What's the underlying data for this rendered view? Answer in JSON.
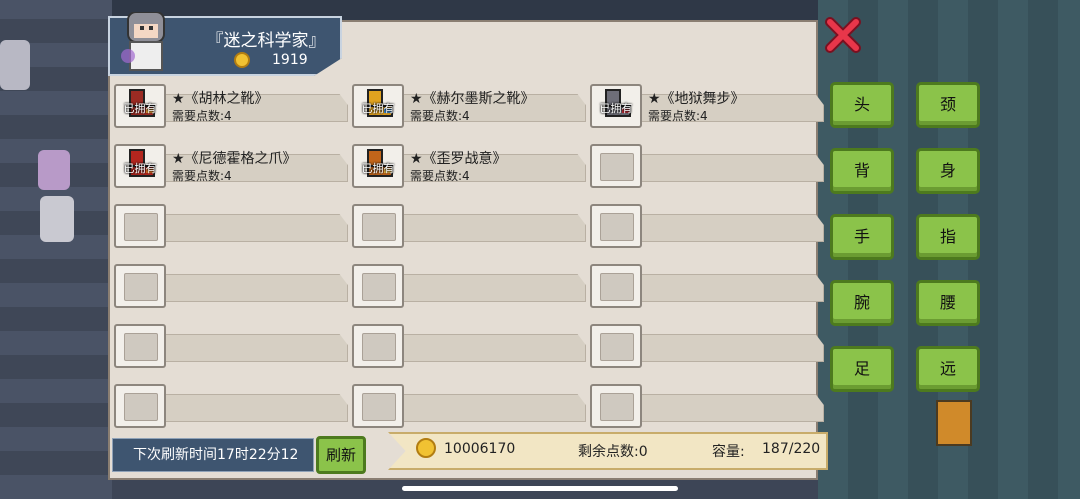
{
  "header": {
    "title": "『迷之科学家』",
    "coins": "1919"
  },
  "items": [
    {
      "name": "★《胡林之靴》",
      "cost": "需要点数:4",
      "owned": "已拥有",
      "color": "#9b2b23",
      "accent": "#e6a03a"
    },
    {
      "name": "★《赫尔墨斯之靴》",
      "cost": "需要点数:4",
      "owned": "已拥有",
      "color": "#e0a21f",
      "accent": "#3f8fd9"
    },
    {
      "name": "★《地狱舞步》",
      "cost": "需要点数:4",
      "owned": "已拥有",
      "color": "#6e6e78",
      "accent": "#c8303a"
    },
    {
      "name": "★《尼德霍格之爪》",
      "cost": "需要点数:4",
      "owned": "已拥有",
      "color": "#b3261e",
      "accent": "#ef7b2c"
    },
    {
      "name": "★《歪罗战意》",
      "cost": "需要点数:4",
      "owned": "已拥有",
      "color": "#c2651a",
      "accent": "#f2c14e"
    }
  ],
  "bottom": {
    "refresh_text": "下次刷新时间17时22分12",
    "refresh_button": "刷新",
    "coins": "10006170",
    "remaining": "剩余点数:0",
    "capacity_label": "容量:",
    "capacity_value": "187/220"
  },
  "categories": [
    "头",
    "颈",
    "背",
    "身",
    "手",
    "指",
    "腕",
    "腰",
    "足",
    "远"
  ],
  "colors": {
    "button_green": "#8bc34a",
    "panel": "#e4ddd4",
    "header": "#3e5570",
    "close_red": "#d7263d"
  }
}
